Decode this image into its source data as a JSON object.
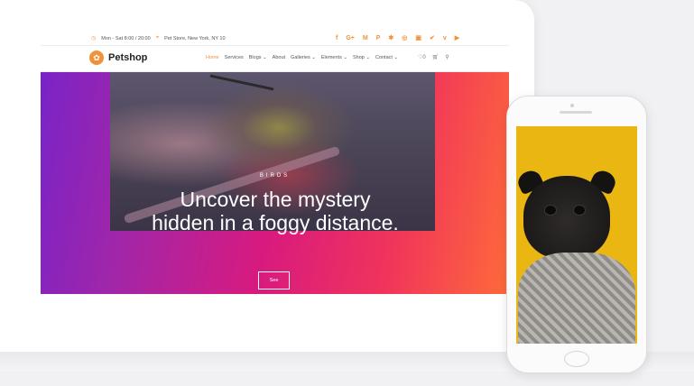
{
  "topbar": {
    "hours": "Mon - Sat 8:00 / 20:00",
    "address": "Pet Store, New York, NY 10",
    "social_icons": [
      "facebook-icon",
      "google-plus-icon",
      "medium-icon",
      "patreon-icon",
      "yelp-icon",
      "instagram-icon",
      "twitch-icon",
      "twitter-icon",
      "vimeo-icon",
      "youtube-icon"
    ]
  },
  "header": {
    "brand": "Petshop",
    "nav": [
      "Home",
      "Services",
      "Blogs ⌄",
      "About",
      "Galleries ⌄",
      "Elements ⌄",
      "Shop ⌄",
      "Contact ⌄"
    ],
    "wishlist_count": "0"
  },
  "hero": {
    "kicker": "BIRDS",
    "title": "Uncover the mystery hidden in a foggy distance.",
    "button": "See",
    "slides_total": 5,
    "active_slide": 5
  },
  "colors": {
    "accent": "#f0923b",
    "hero_start": "#7a23c7",
    "hero_mid": "#d81a7f",
    "hero_end": "#ff6a3a",
    "phone_bg": "#e9b612"
  }
}
